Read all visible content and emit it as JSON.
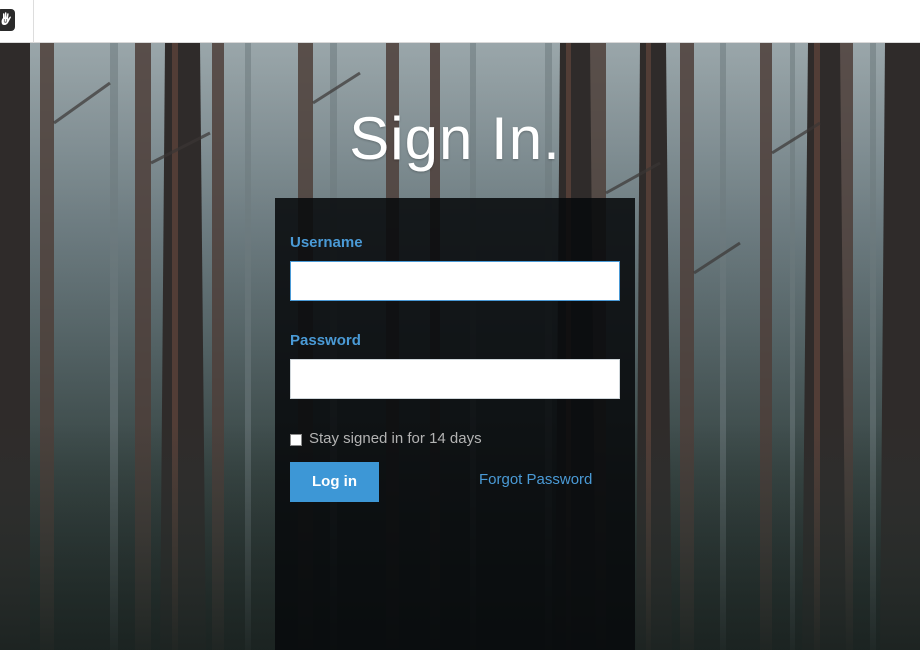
{
  "toolbar": {
    "logo_icon": "hand-logo-icon"
  },
  "page": {
    "title": "Sign In."
  },
  "form": {
    "username_label": "Username",
    "username_value": "",
    "password_label": "Password",
    "password_value": "",
    "remember_label": "Stay signed in for 14 days",
    "remember_checked": false,
    "login_label": "Log in",
    "forgot_label": "Forgot Password"
  },
  "colors": {
    "accent": "#3d97d6",
    "label": "#4a9ad6",
    "panel": "#0a0c0e",
    "title": "#ffffff"
  }
}
